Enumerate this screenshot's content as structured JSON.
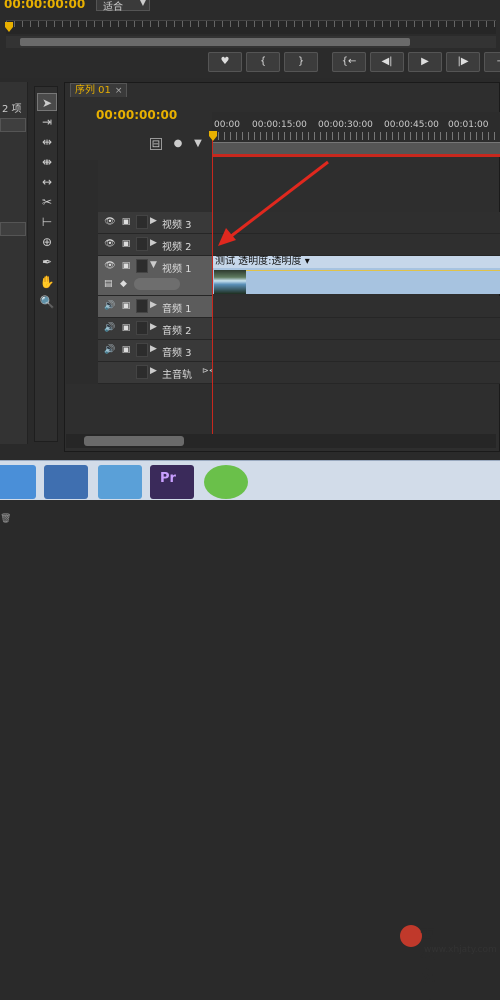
{
  "monitor": {
    "timecode": "00:00:00:00",
    "fit_label": "适合",
    "transport": [
      "♥",
      "{",
      "}",
      "{←",
      "◀|",
      "▶",
      "|▶",
      "→"
    ]
  },
  "left_panel": {
    "item_count": "2 项"
  },
  "tools": [
    "selection-tool",
    "track-select-tool",
    "ripple-edit-tool",
    "rolling-edit-tool",
    "rate-stretch-tool",
    "razor-tool",
    "slip-tool",
    "slide-tool",
    "pen-tool",
    "hand-tool",
    "zoom-tool"
  ],
  "sequence": {
    "tab_label": "序列 01",
    "tab_close": "×",
    "timecode": "00:00:00:00",
    "ruler_labels": [
      "00:00",
      "00:00:15:00",
      "00:00:30:00",
      "00:00:45:00",
      "00:01:00"
    ],
    "tracks": {
      "video3": "视频 3",
      "video2": "视频 2",
      "video1": "视频 1",
      "audio1": "音频 1",
      "audio2": "音频 2",
      "audio3": "音频 3",
      "master": "主音轨"
    },
    "clip_label": "测试  透明度:透明度 ▾"
  },
  "taskbar": {
    "watermark_title": "雪花家园",
    "watermark_url": "www.xhjaty.com"
  },
  "colors": {
    "accent_timecode": "#e8b000",
    "playhead": "#c8281e",
    "clip": "#a7c3e0",
    "annotation_arrow": "#e0281e"
  }
}
